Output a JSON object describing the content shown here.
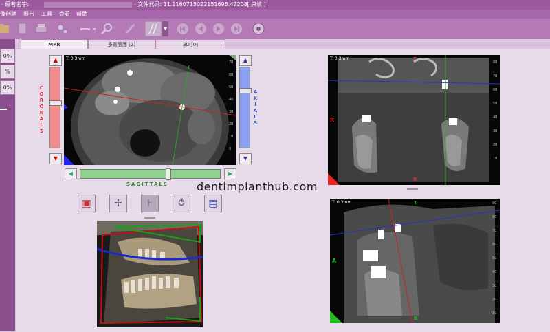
{
  "titlebar": {
    "patient_label": "- 患者名字:",
    "file_code_label": "- 文件代码: 11.11607150221516 95.42203",
    "file_code": "- 文件代码: 11.1160715022151695.42203",
    "readonly": "- [ 只读 ]"
  },
  "menubar": {
    "items": [
      "像创建",
      "报告",
      "工具",
      "查看",
      "帮助"
    ]
  },
  "leftstrip": {
    "items": [
      "0%",
      "%",
      "0%"
    ]
  },
  "tabs": [
    "MPR",
    "多重层面 [2]",
    "3D [0]"
  ],
  "axial_view": {
    "thickness": "T: 0.3mm",
    "coronals_label": "CORONALS",
    "axials_label": "AXIALS",
    "sagittals_label": "SAGITTALS"
  },
  "coronal_view": {
    "thickness": "T: 0.3mm",
    "label_r": "R",
    "label_b": "B",
    "label_t": "T"
  },
  "sagittal_view": {
    "thickness": "T: 0.3mm",
    "label_a": "A",
    "label_b": "B",
    "label_t": "T"
  },
  "watermark": "dentimplanthub.com",
  "colors": {
    "titlebar": "#9a5a9c",
    "toolbar": "#b37ab6",
    "coronal_slider": "#f08a8a",
    "axial_slider": "#8aa0f0",
    "sagittal_slider": "#8ed28e"
  }
}
